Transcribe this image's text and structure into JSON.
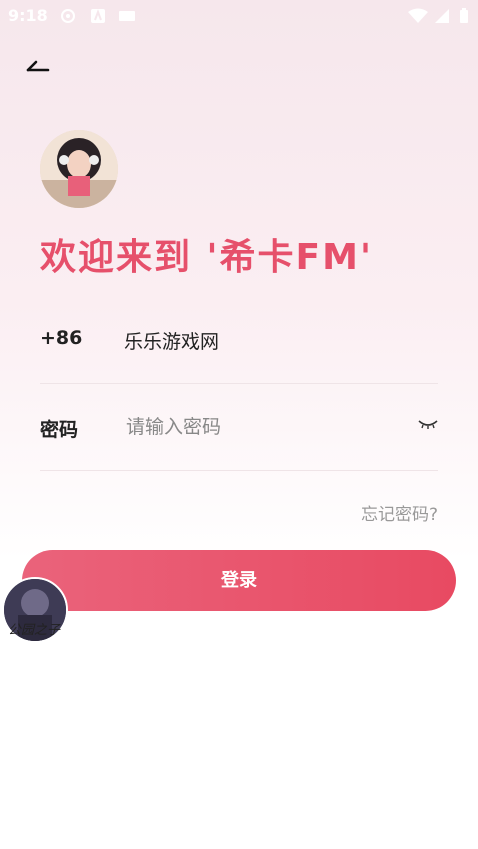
{
  "status_bar": {
    "time": "9:18"
  },
  "header": {
    "back_label": ""
  },
  "welcome": {
    "text": "欢迎来到 '希卡FM'"
  },
  "phone_row": {
    "country_code": "+86",
    "value": "乐乐游戏网"
  },
  "password_row": {
    "label": "密码",
    "placeholder": "请输入密码"
  },
  "forgot": {
    "label": "忘记密码?"
  },
  "login_button": {
    "label": "登录"
  },
  "float_avatar": {
    "label": "公园之子"
  },
  "colors": {
    "accent": "#e6506b",
    "button": "#e84a62"
  },
  "icons": [
    "sync-icon",
    "a-icon",
    "keyboard-icon",
    "wifi-icon",
    "signal-icon",
    "battery-icon",
    "back-arrow-icon",
    "eye-closed-icon"
  ]
}
